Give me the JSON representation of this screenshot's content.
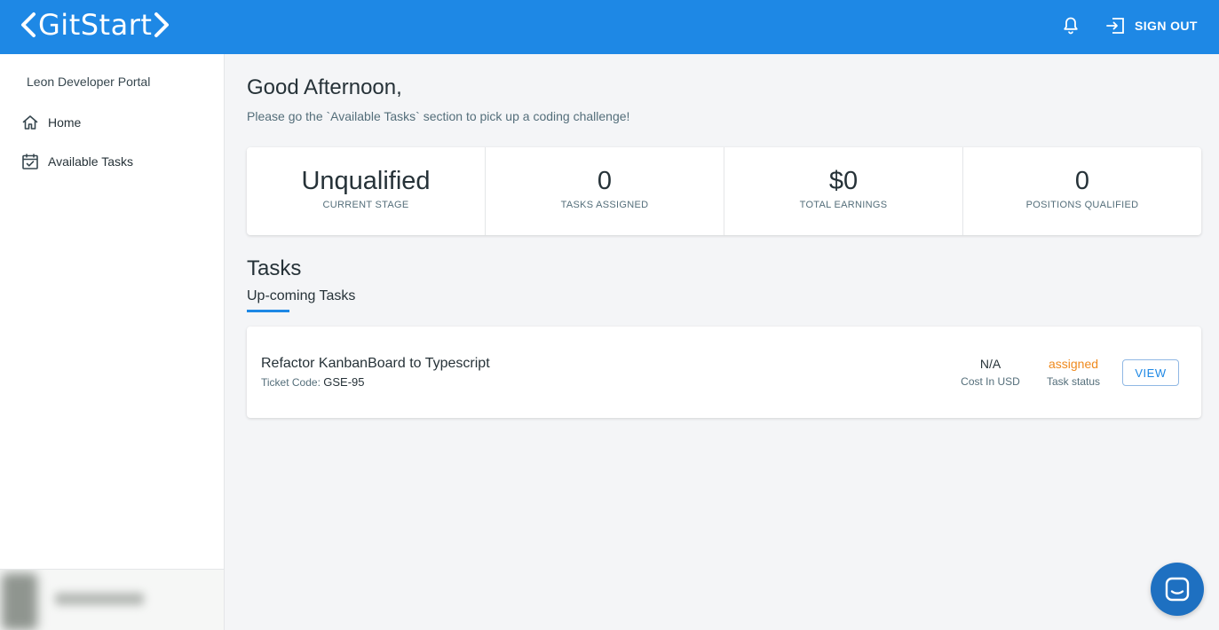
{
  "app": {
    "logo_text": "GitStart",
    "brand_color": "#1e88e5",
    "header": {
      "notification_icon": "bell-icon",
      "sign_out_icon": "sign-out-icon",
      "sign_out_label": "SIGN OUT"
    }
  },
  "sidebar": {
    "title": "Leon Developer Portal",
    "items": [
      {
        "label": "Home",
        "icon": "home-icon"
      },
      {
        "label": "Available Tasks",
        "icon": "calendar-check-icon"
      }
    ]
  },
  "main": {
    "greeting": "Good Afternoon,",
    "subtext": "Please go the `Available Tasks` section to pick up a coding challenge!",
    "stats": [
      {
        "value": "Unqualified",
        "label": "CURRENT STAGE"
      },
      {
        "value": "0",
        "label": "TASKS ASSIGNED"
      },
      {
        "value": "$0",
        "label": "TOTAL EARNINGS"
      },
      {
        "value": "0",
        "label": "POSITIONS QUALIFIED"
      }
    ],
    "tasks_heading": "Tasks",
    "tab_label": "Up-coming Tasks",
    "tasks": [
      {
        "title": "Refactor KanbanBoard to Typescript",
        "ticket_label": "Ticket Code:",
        "ticket_code": "GSE-95",
        "cost_value": "N/A",
        "cost_label": "Cost In USD",
        "status_value": "assigned",
        "status_label": "Task status",
        "status_color": "#ef8a1e",
        "view_label": "VIEW"
      }
    ]
  },
  "chat": {
    "icon": "chat-icon"
  }
}
